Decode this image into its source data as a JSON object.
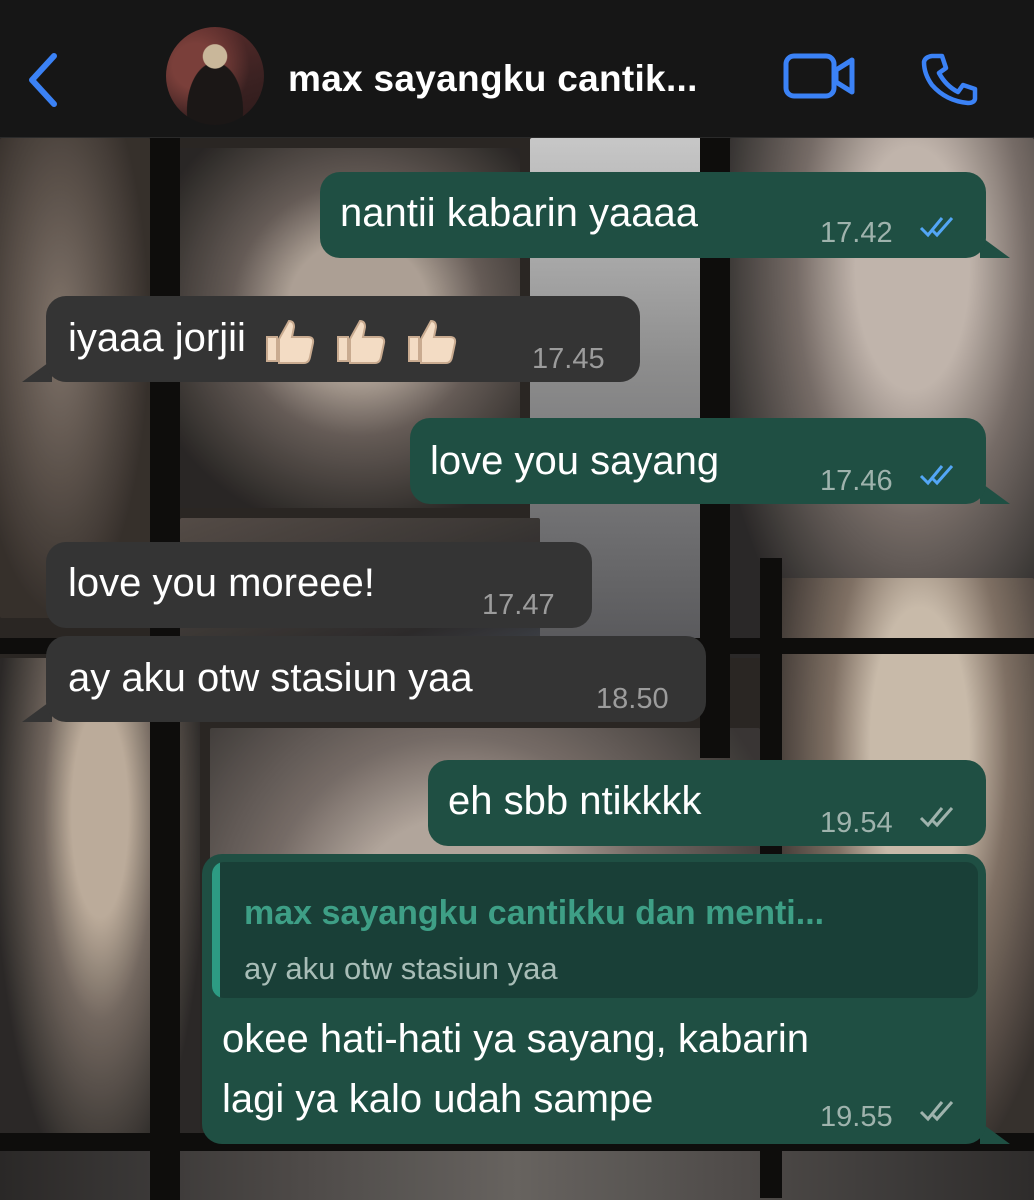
{
  "header": {
    "title": "max sayangku cantik...",
    "back_icon": "chevron-left-icon",
    "video_icon": "video-camera-icon",
    "call_icon": "phone-icon",
    "accent_color": "#3b82f6"
  },
  "messages": [
    {
      "direction": "out",
      "text": "nantii kabarin yaaaa",
      "time": "17.42",
      "status": "read"
    },
    {
      "direction": "in",
      "text": "iyaaa jorjii",
      "emoji": "thumbs-up x3",
      "time": "17.45"
    },
    {
      "direction": "out",
      "text": "love you sayang",
      "time": "17.46",
      "status": "read"
    },
    {
      "direction": "in",
      "text": "love you moreee!",
      "time": "17.47"
    },
    {
      "direction": "in",
      "text": "ay aku otw stasiun yaa",
      "time": "18.50"
    },
    {
      "direction": "out",
      "text": "eh sbb ntikkkk",
      "time": "19.54",
      "status": "delivered"
    },
    {
      "direction": "out",
      "reply_to": {
        "name": "max sayangku cantikku dan menti...",
        "text": "ay aku otw stasiun yaa"
      },
      "lines": [
        "okee hati-hati ya sayang, kabarin",
        "lagi ya kalo udah sampe"
      ],
      "time": "19.55",
      "status": "delivered"
    }
  ],
  "colors": {
    "outgoing_bubble": "#1f4f43",
    "incoming_bubble": "#343434",
    "read_ticks": "#53a6f5",
    "delivered_ticks": "#9fb3ad",
    "quote_name": "#3e9f86"
  }
}
